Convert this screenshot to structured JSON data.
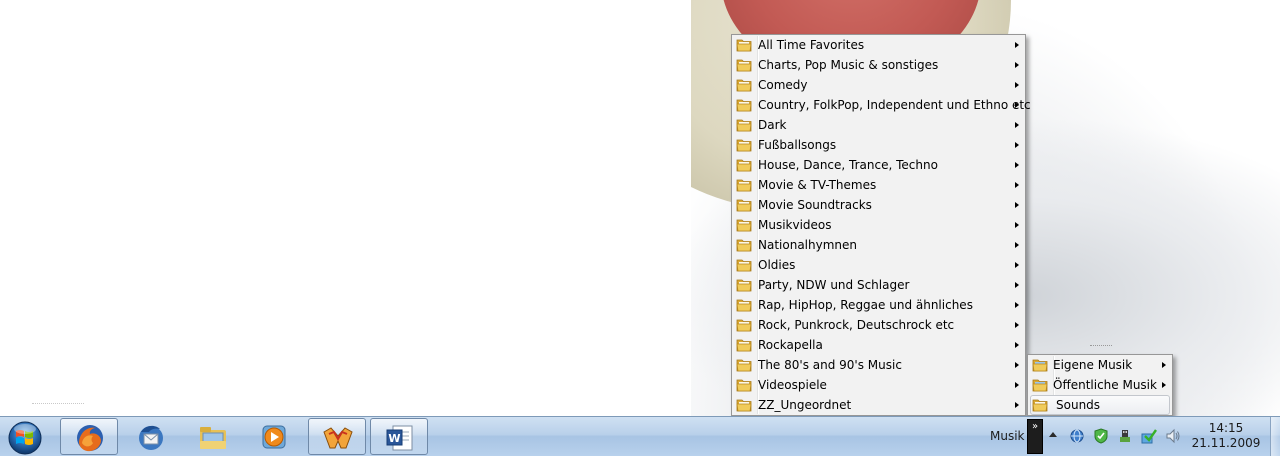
{
  "music_menu": {
    "items": [
      {
        "label": "All Time Favorites"
      },
      {
        "label": "Charts, Pop Music & sonstiges"
      },
      {
        "label": "Comedy"
      },
      {
        "label": "Country, FolkPop, Independent und Ethno etc"
      },
      {
        "label": "Dark"
      },
      {
        "label": "Fußballsongs"
      },
      {
        "label": "House, Dance, Trance, Techno"
      },
      {
        "label": "Movie & TV-Themes"
      },
      {
        "label": "Movie Soundtracks"
      },
      {
        "label": "Musikvideos"
      },
      {
        "label": "Nationalhymnen"
      },
      {
        "label": "Oldies"
      },
      {
        "label": "Party, NDW und Schlager"
      },
      {
        "label": "Rap, HipHop, Reggae und ähnliches"
      },
      {
        "label": "Rock, Punkrock, Deutschrock etc"
      },
      {
        "label": "Rockapella"
      },
      {
        "label": "The 80's and 90's Music"
      },
      {
        "label": "Videospiele"
      },
      {
        "label": "ZZ_Ungeordnet"
      }
    ]
  },
  "sub_menu": {
    "items": [
      {
        "label": "Eigene Musik",
        "has_submenu": true
      },
      {
        "label": "Öffentliche Musik",
        "has_submenu": true
      },
      {
        "label": "Sounds",
        "has_submenu": false,
        "selected": true
      }
    ]
  },
  "taskbar": {
    "pinned": [
      {
        "icon": "firefox-icon",
        "active": true
      },
      {
        "icon": "thunderbird-icon",
        "active": false
      },
      {
        "icon": "windows-explorer-icon",
        "active": false
      },
      {
        "icon": "media-player-icon",
        "active": false
      },
      {
        "icon": "winamp-icon",
        "active": true
      },
      {
        "icon": "word-icon",
        "active": true
      }
    ],
    "toolbar_label": "Musik",
    "toolbar_chevron": "»",
    "clock_time": "14:15",
    "clock_date": "21.11.2009",
    "tray_icons": [
      "network-icon",
      "security-shield-icon",
      "usb-device-icon",
      "sync-check-icon",
      "volume-icon"
    ]
  },
  "colors": {
    "menu_background": "#f2f2f2",
    "menu_border": "#979797",
    "taskbar_top": "#cfe0f2",
    "taskbar_bottom": "#a8c4e4",
    "folder_yellow": "#e8c04a"
  }
}
